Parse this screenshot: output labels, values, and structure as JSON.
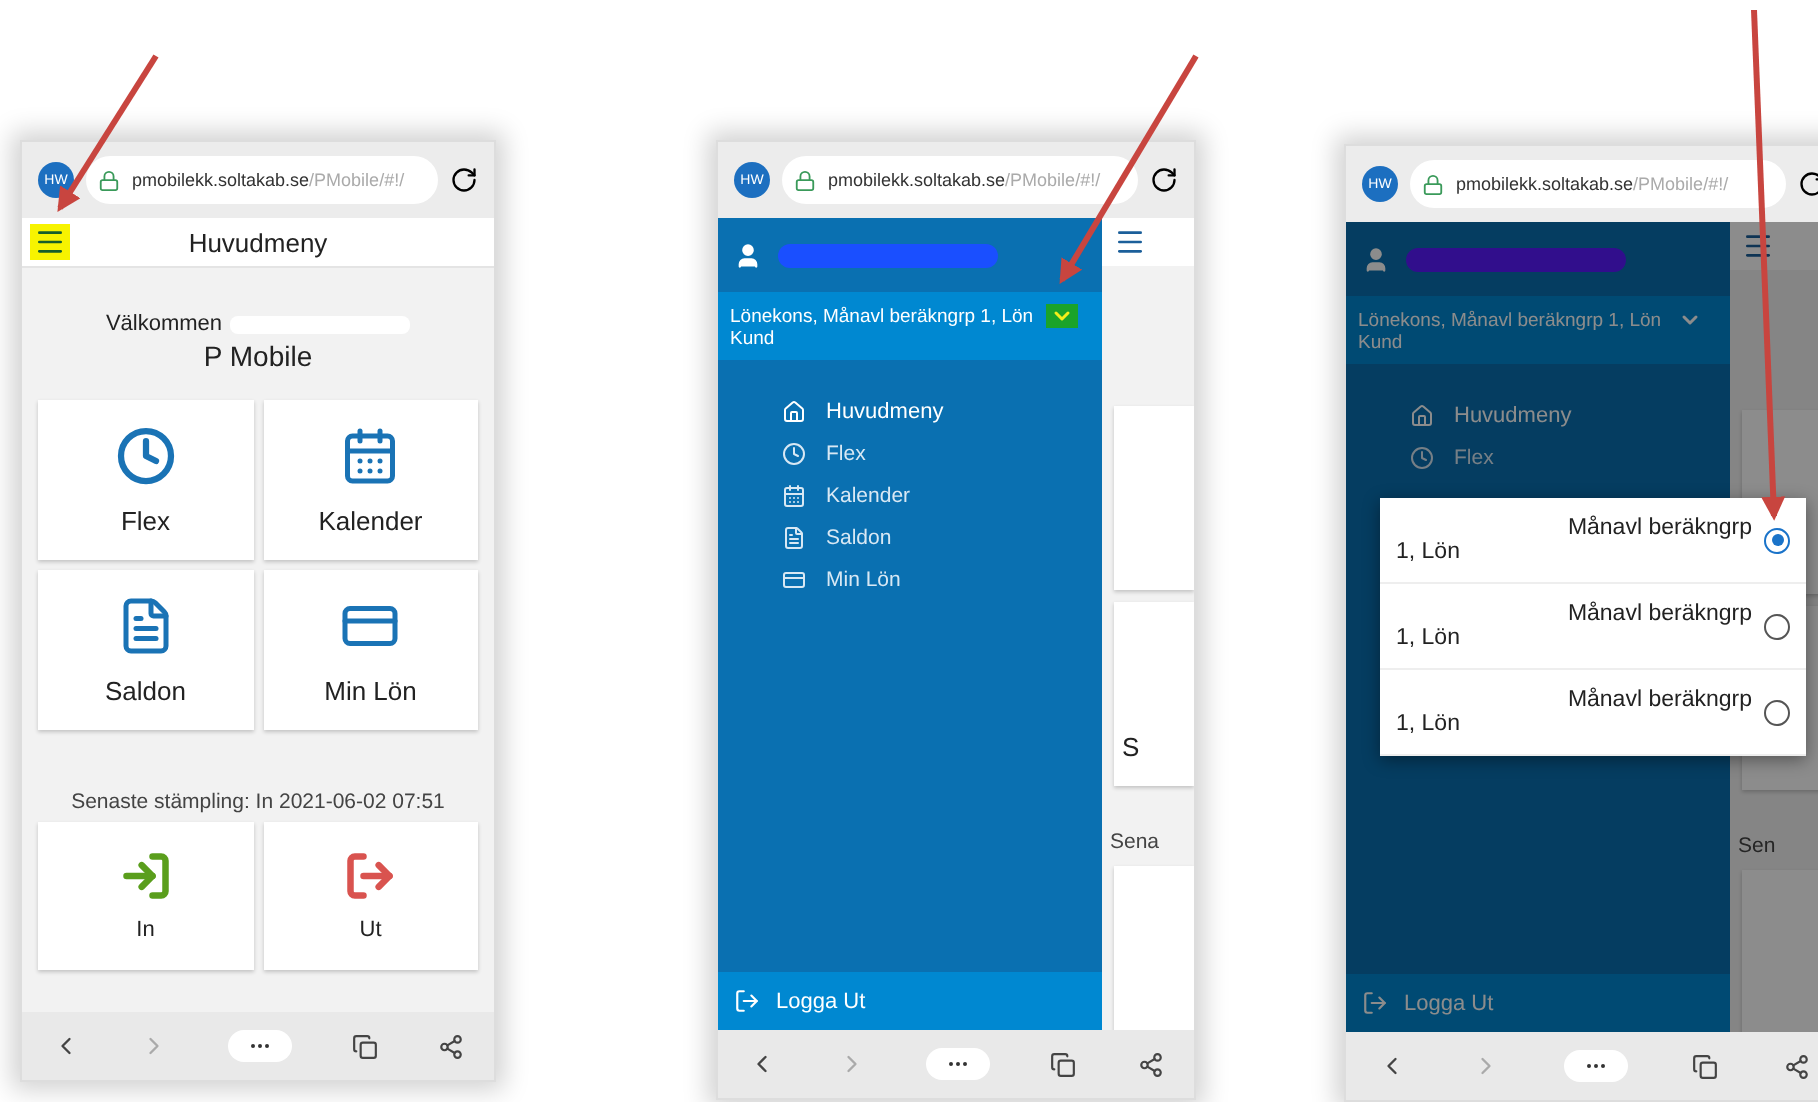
{
  "phones": [
    {
      "kind": "home",
      "arrow": true,
      "browser": {
        "avatar": "HW",
        "host": "pmobilekk.soltakab.se",
        "path": "/PMobile/#!/"
      },
      "header": {
        "title": "Huvudmeny",
        "menu_highlighted": true
      },
      "welcome": "Välkommen",
      "app_name": "P Mobile",
      "tiles": [
        {
          "label": "Flex"
        },
        {
          "label": "Kalender"
        },
        {
          "label": "Saldon"
        },
        {
          "label": "Min Lön"
        }
      ],
      "last_stamp": "Senaste stämpling: In 2021-06-02 07:51",
      "stamp_buttons": [
        {
          "label": "In"
        },
        {
          "label": "Ut"
        }
      ]
    },
    {
      "kind": "drawer",
      "arrow": true,
      "browser": {
        "avatar": "HW",
        "host": "pmobilekk.soltakab.se",
        "path": "/PMobile/#!/"
      },
      "drawer": {
        "account": "Lönekons, Månavl beräkngrp 1, Lön",
        "account_line2": "Kund",
        "chevron_highlighted": true,
        "items": [
          {
            "label": "Huvudmeny",
            "selected": true
          },
          {
            "label": "Flex",
            "selected": false
          },
          {
            "label": "Kalender",
            "selected": false
          },
          {
            "label": "Saldon",
            "selected": false
          },
          {
            "label": "Min Lön",
            "selected": false
          }
        ],
        "logout": "Logga Ut"
      },
      "peek": {
        "tile_text": "S",
        "stamp_text": "Sena"
      }
    },
    {
      "kind": "dialog",
      "arrow": true,
      "browser": {
        "avatar": "HW",
        "host": "pmobilekk.soltakab.se",
        "path": "/PMobile/#!/"
      },
      "drawer": {
        "account": "Lönekons, Månavl beräkngrp 1, Lön",
        "account_line2": "Kund",
        "chevron_highlighted": false,
        "items": [
          {
            "label": "Huvudmeny",
            "selected": true
          },
          {
            "label": "Flex",
            "selected": false
          }
        ],
        "logout": "Logga Ut"
      },
      "peek": {
        "stamp_text": "Sen"
      },
      "dialog": {
        "options": [
          {
            "line1": "Månavl beräkngrp",
            "line2": "1, Lön",
            "selected": true
          },
          {
            "line1": "Månavl beräkngrp",
            "line2": "1, Lön",
            "selected": false
          },
          {
            "line1": "Månavl beräkngrp",
            "line2": "1, Lön",
            "selected": false
          }
        ]
      }
    }
  ]
}
